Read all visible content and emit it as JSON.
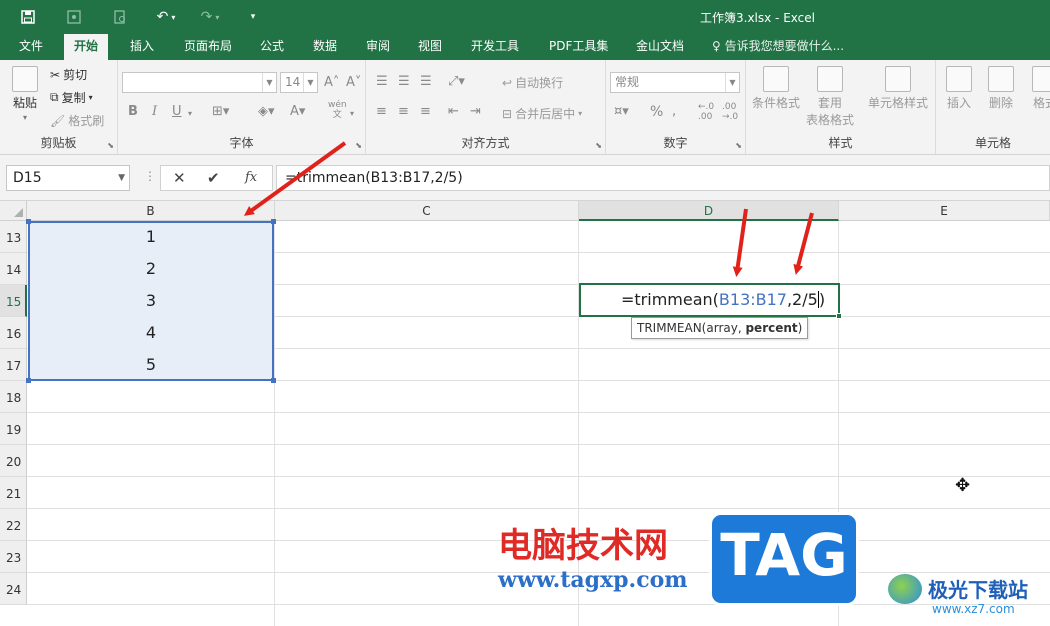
{
  "window": {
    "title": "工作簿3.xlsx - Excel"
  },
  "quick_access": {
    "save_icon": "save-icon",
    "touch_icon": "touch-mode-icon",
    "print_preview_icon": "print-preview-icon",
    "undo_icon": "undo-icon",
    "redo_icon": "redo-icon",
    "customize_icon": "customize-qat-icon"
  },
  "ribbon_tabs": [
    "文件",
    "开始",
    "插入",
    "页面布局",
    "公式",
    "数据",
    "审阅",
    "视图",
    "开发工具",
    "PDF工具集",
    "金山文档"
  ],
  "active_tab": "开始",
  "tell_me": "告诉我您想要做什么...",
  "groups": {
    "clipboard": {
      "label": "剪贴板",
      "paste": "粘贴",
      "cut": "剪切",
      "copy": "复制",
      "format_painter": "格式刷"
    },
    "font": {
      "label": "字体",
      "font_size": "14",
      "bold": "B",
      "italic": "I",
      "underline": "U",
      "wen": "wén",
      "wen2": "文"
    },
    "alignment": {
      "label": "对齐方式",
      "wrap": "自动换行",
      "merge": "合并后居中"
    },
    "number": {
      "label": "数字",
      "format": "常规",
      "percent": "%"
    },
    "styles": {
      "label": "样式",
      "cond": "条件格式",
      "table1": "套用",
      "table2": "表格格式",
      "cell_styles": "单元格样式"
    },
    "cells": {
      "label": "单元格",
      "insert": "插入",
      "delete": "删除",
      "format": "格式"
    }
  },
  "formula_bar": {
    "name_box": "D15",
    "cancel": "✕",
    "enter": "✔",
    "fx": "fx",
    "formula": "=trimmean(B13:B17,2/5)"
  },
  "columns": [
    "B",
    "C",
    "D",
    "E"
  ],
  "rows": [
    "13",
    "14",
    "15",
    "16",
    "17",
    "18",
    "19",
    "20",
    "21",
    "22",
    "23",
    "24"
  ],
  "cells": {
    "B13": "1",
    "B14": "2",
    "B15": "3",
    "B16": "4",
    "B17": "5"
  },
  "edit": {
    "prefix": "=trimmean(",
    "ref": "B13:B17",
    "rest": ",2/5",
    "close": ")"
  },
  "tooltip": {
    "fn": "TRIMMEAN(array, ",
    "bold_arg": "percent",
    "end": ")"
  },
  "watermark": {
    "site_cn": "电脑技术网",
    "site_url": "www.tagxp.com",
    "tag": "TAG",
    "xz_name": "极光下载站",
    "xz_url": "www.xz7.com"
  },
  "colors": {
    "excel_green": "#217346",
    "selection_blue": "#4472c4",
    "arrow_red": "#e0221b"
  }
}
